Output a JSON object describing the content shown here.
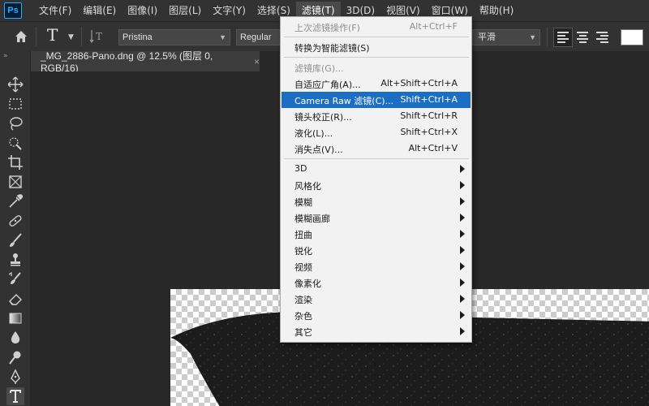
{
  "menubar": {
    "logo": "Ps",
    "items": [
      "文件(F)",
      "编辑(E)",
      "图像(I)",
      "图层(L)",
      "文字(Y)",
      "选择(S)",
      "滤镜(T)",
      "3D(D)",
      "视图(V)",
      "窗口(W)",
      "帮助(H)"
    ],
    "active_index": 6
  },
  "options": {
    "tool_glyph": "T",
    "font_family": "Pristina",
    "font_style": "Regular",
    "antialias": "平滑",
    "text_color": "#ffffff"
  },
  "document_tab": {
    "title": "_MG_2886-Pano.dng @ 12.5% (图层 0, RGB/16)",
    "close": "×"
  },
  "filter_menu": {
    "items": [
      {
        "label": "上次滤镜操作(F)",
        "shortcut": "Alt+Ctrl+F",
        "disabled": true
      },
      {
        "separator": true
      },
      {
        "label": "转换为智能滤镜(S)"
      },
      {
        "separator": true
      },
      {
        "label": "滤镜库(G)...",
        "disabled": true
      },
      {
        "label": "自适应广角(A)...",
        "shortcut": "Alt+Shift+Ctrl+A"
      },
      {
        "label": "Camera Raw 滤镜(C)...",
        "shortcut": "Shift+Ctrl+A",
        "highlighted": true
      },
      {
        "label": "镜头校正(R)...",
        "shortcut": "Shift+Ctrl+R"
      },
      {
        "label": "液化(L)...",
        "shortcut": "Shift+Ctrl+X"
      },
      {
        "label": "消失点(V)...",
        "shortcut": "Alt+Ctrl+V"
      },
      {
        "separator": true
      },
      {
        "label": "3D",
        "submenu": true
      },
      {
        "label": "风格化",
        "submenu": true
      },
      {
        "label": "模糊",
        "submenu": true
      },
      {
        "label": "模糊画廊",
        "submenu": true
      },
      {
        "label": "扭曲",
        "submenu": true
      },
      {
        "label": "锐化",
        "submenu": true
      },
      {
        "label": "视频",
        "submenu": true
      },
      {
        "label": "像素化",
        "submenu": true
      },
      {
        "label": "渲染",
        "submenu": true
      },
      {
        "label": "杂色",
        "submenu": true
      },
      {
        "label": "其它",
        "submenu": true
      }
    ]
  },
  "toolbar": {
    "tools": [
      "move-tool",
      "marquee-tool",
      "lasso-tool",
      "quick-select-tool",
      "crop-tool",
      "frame-tool",
      "eyedropper-tool",
      "healing-brush-tool",
      "brush-tool",
      "clone-stamp-tool",
      "history-brush-tool",
      "eraser-tool",
      "gradient-tool",
      "blur-tool",
      "dodge-tool",
      "pen-tool",
      "type-tool"
    ],
    "active": "type-tool"
  },
  "colors": {
    "accent": "#31a8ff",
    "menu_highlight": "#1c6ec4",
    "ui_dark": "#323232",
    "canvas_bg": "#282828"
  }
}
